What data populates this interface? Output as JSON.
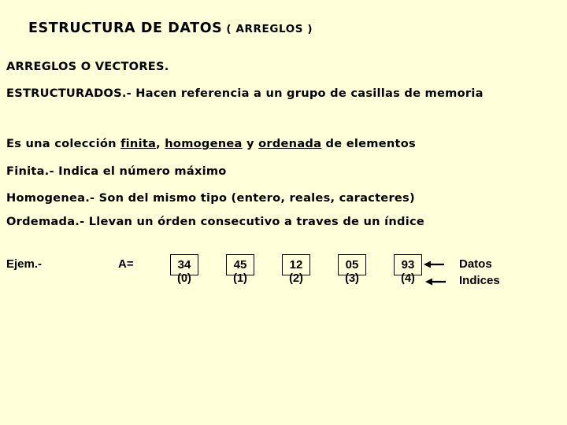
{
  "slide": {
    "background_color": "#ffffd9",
    "text_color": "#000000",
    "title": {
      "main": "ESTRUCTURA DE DATOS",
      "paren": "( ARREGLOS )"
    },
    "body": {
      "line1": "ARREGLOS O VECTORES.",
      "line2": "ESTRUCTURADOS.- Hacen referencia a un grupo de casillas de memoria",
      "line3": {
        "part1": "Es una colección ",
        "underlined1": "finita",
        "part2": ", ",
        "underlined2": "homogenea",
        "part3": " y ",
        "underlined3": "ordenada",
        "part4": " de elementos"
      },
      "line4": "Finita.- Indica el número máximo",
      "line5": "Homogenea.- Son del mismo tipo (entero, reales, caracteres)",
      "line6": "Ordemada.- Llevan un órden consecutivo a traves de un índice"
    },
    "example": {
      "label": "Ejem.-",
      "array_name": "A=",
      "cells": [
        {
          "value": "34",
          "index": "(0)"
        },
        {
          "value": "45",
          "index": "(1)"
        },
        {
          "value": "12",
          "index": "(2)"
        },
        {
          "value": "05",
          "index": "(3)"
        },
        {
          "value": "93",
          "index": "(4)"
        }
      ],
      "annotations": {
        "datos": "Datos",
        "indices": "Indices"
      }
    }
  }
}
